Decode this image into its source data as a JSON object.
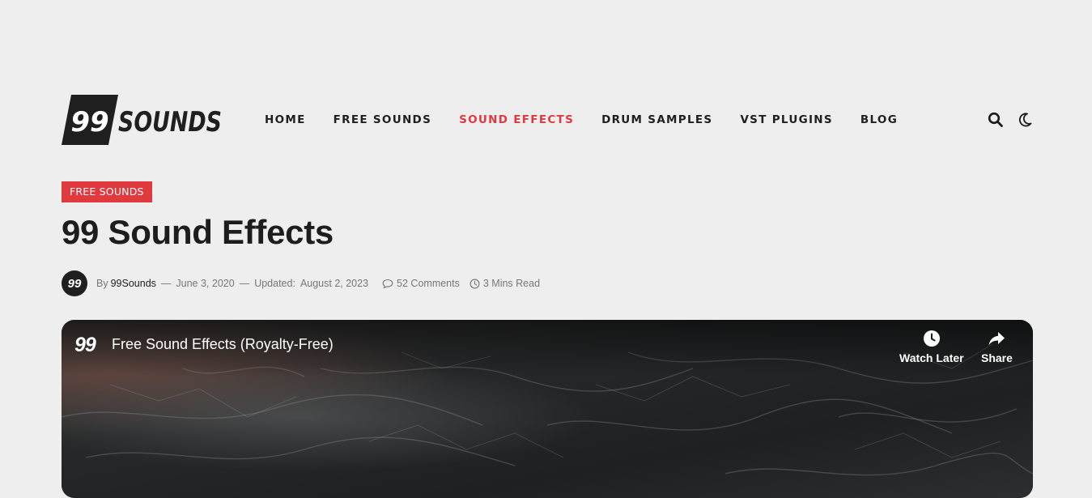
{
  "logo": {
    "number": "99",
    "word": "SOUNDS"
  },
  "nav": {
    "items": [
      {
        "label": "HOME",
        "active": false
      },
      {
        "label": "FREE SOUNDS",
        "active": false
      },
      {
        "label": "SOUND EFFECTS",
        "active": true
      },
      {
        "label": "DRUM SAMPLES",
        "active": false
      },
      {
        "label": "VST PLUGINS",
        "active": false
      },
      {
        "label": "BLOG",
        "active": false
      }
    ]
  },
  "header_icons": [
    "search-icon",
    "moon-icon"
  ],
  "post": {
    "category": "FREE SOUNDS",
    "title": "99 Sound Effects",
    "meta": {
      "avatar_text": "99",
      "by_label": "By",
      "author": "99Sounds",
      "separator": "—",
      "date": "June 3, 2020",
      "updated_label": "Updated:",
      "updated_date": "August 2, 2023",
      "comments": "52 Comments",
      "read_time": "3 Mins Read"
    }
  },
  "video": {
    "channel_logo": "99",
    "title": "Free Sound Effects (Royalty-Free)",
    "watch_later_label": "Watch Later",
    "share_label": "Share"
  },
  "colors": {
    "background": "#eeeeee",
    "accent": "#e0393e",
    "text": "#1d1d1d",
    "muted": "#777777"
  }
}
